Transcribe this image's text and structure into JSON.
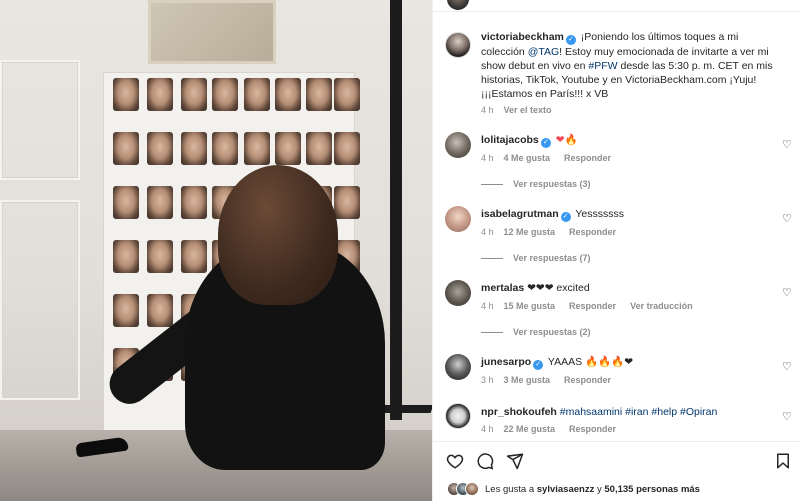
{
  "post": {
    "author": "victoriabeckham",
    "caption_parts": {
      "lead": "¡Poniendo los últimos toques a mi colección ",
      "tag": "@TAG",
      "mid": "! Estoy muy emocionada de invitarte a ver mi show debut en vivo en ",
      "hashtag": "#PFW",
      "rest": " desde las 5:30 p. m. CET en mis historias, TikTok, Youtube y en VictoriaBeckham.com ¡Yuju! ¡¡¡Estamos en París!!! x VB"
    },
    "time": "4 h",
    "see_translation": "Ver el texto"
  },
  "comments": [
    {
      "username": "lolitajacobs",
      "verified": true,
      "text": "❤🔥",
      "time": "4 h",
      "likes": "4 Me gusta",
      "reply": "Responder",
      "view_replies": "Ver respuestas (3)"
    },
    {
      "username": "isabelagrutman",
      "verified": true,
      "text": "Yesssssss",
      "time": "4 h",
      "likes": "12 Me gusta",
      "reply": "Responder",
      "view_replies": "Ver respuestas (7)"
    },
    {
      "username": "mertalas",
      "verified": false,
      "text": "❤❤❤ excited",
      "time": "4 h",
      "likes": "15 Me gusta",
      "reply": "Responder",
      "translate": "Ver traducción",
      "view_replies": "Ver respuestas (2)"
    },
    {
      "username": "junesarpo",
      "verified": true,
      "text": "YAAAS 🔥🔥🔥❤",
      "time": "3 h",
      "likes": "3 Me gusta",
      "reply": "Responder"
    },
    {
      "username": "npr_shokoufeh",
      "verified": false,
      "text": "#mahsaamini #iran #help #Opiran",
      "time": "4 h",
      "likes": "22 Me gusta",
      "reply": "Responder"
    }
  ],
  "likes_line": {
    "prefix": "Les gusta a",
    "user": "sylviasaenzz",
    "connector": "y",
    "count": "50,135 personas más"
  },
  "icons": [
    "heart-icon",
    "comment-icon",
    "share-icon",
    "bookmark-icon",
    "verified-icon"
  ],
  "colors": {
    "verified": "#3897f0",
    "link": "#00376b",
    "muted": "#8e8e8e",
    "heart": "#ed4956"
  }
}
